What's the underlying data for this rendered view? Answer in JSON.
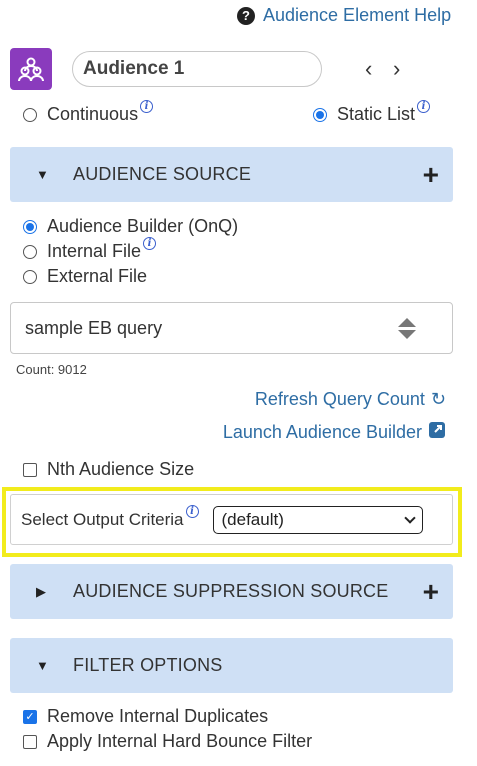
{
  "help": {
    "label": "Audience Element Help",
    "icon": "question-circle-icon"
  },
  "audience": {
    "name": "Audience 1",
    "icon": "audience-group-icon",
    "accent": "#8a3bbd"
  },
  "type_options": [
    {
      "label": "Continuous",
      "selected": false
    },
    {
      "label": "Static List",
      "selected": true
    }
  ],
  "sections": {
    "source": {
      "label": "AUDIENCE SOURCE",
      "expanded": true
    },
    "suppression": {
      "label": "AUDIENCE SUPPRESSION SOURCE",
      "expanded": false
    },
    "filter": {
      "label": "FILTER OPTIONS",
      "expanded": true
    }
  },
  "source_options": [
    {
      "label": "Audience Builder (OnQ)",
      "selected": true
    },
    {
      "label": "Internal File",
      "selected": false,
      "info": true
    },
    {
      "label": "External File",
      "selected": false
    }
  ],
  "query": {
    "selected": "sample EB query",
    "count_label": "Count: 9012"
  },
  "links": {
    "refresh": "Refresh Query Count",
    "launch": "Launch Audience Builder"
  },
  "nth": {
    "label": "Nth Audience Size",
    "checked": false
  },
  "output_criteria": {
    "label": "Select Output Criteria",
    "selected": "(default)"
  },
  "filters": [
    {
      "label": "Remove Internal Duplicates",
      "checked": true
    },
    {
      "label": "Apply Internal Hard Bounce Filter",
      "checked": false
    }
  ],
  "colors": {
    "section_bg": "#cfe0f5",
    "link": "#2e6da4",
    "highlight": "#f2ec1c",
    "radio_on": "#1a73e8"
  }
}
